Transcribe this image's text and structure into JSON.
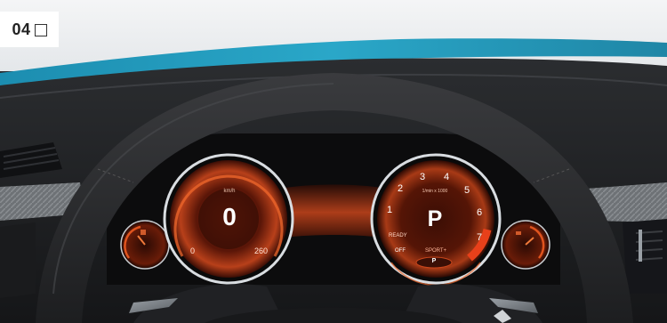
{
  "badge": {
    "number": "04",
    "checkbox_checked": false
  },
  "cluster": {
    "speedometer": {
      "unit": "km/h",
      "value": "0",
      "scale_min": "0",
      "scale_max": "260"
    },
    "tachometer": {
      "unit": "1/min x 1000",
      "gear": "P",
      "ticks": [
        "1",
        "2",
        "3",
        "4",
        "5",
        "6",
        "7"
      ],
      "mode_left": "READY",
      "off_label": "OFF",
      "drive_mode": "SPORT+",
      "gear_indicator": "P"
    }
  },
  "colors": {
    "accent_orange": "#e0541e",
    "body_blue": "#2a9fbe",
    "dash_dark": "#1a1b1d"
  }
}
